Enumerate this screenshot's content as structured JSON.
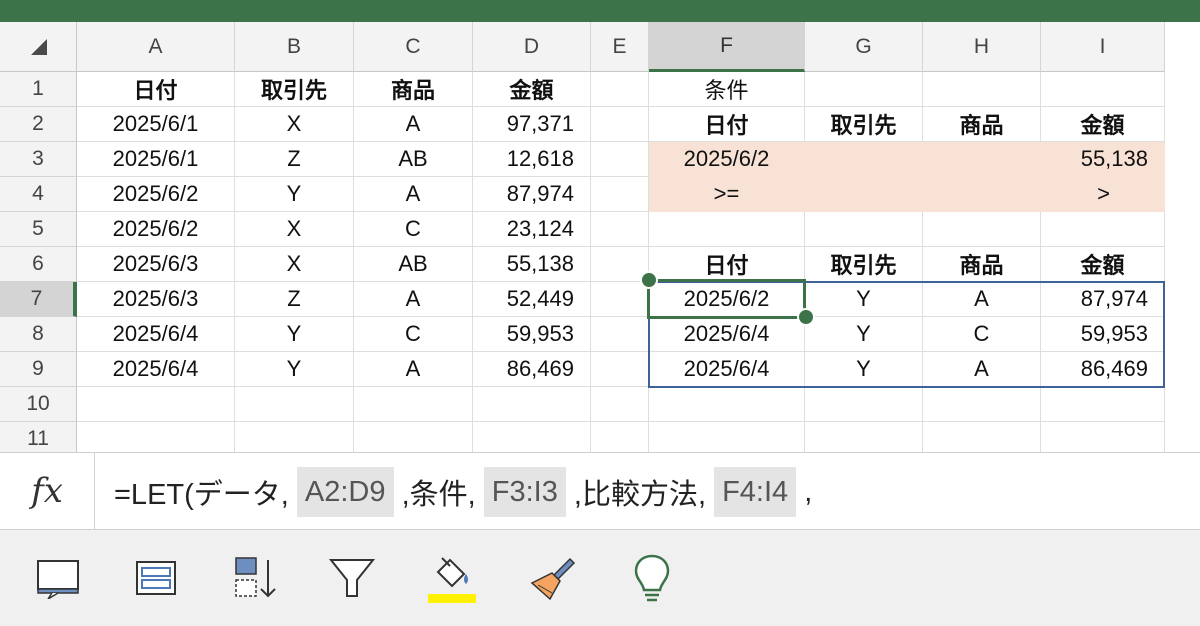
{
  "columns": [
    "A",
    "B",
    "C",
    "D",
    "E",
    "F",
    "G",
    "H",
    "I"
  ],
  "selected_column": "F",
  "rows": [
    "1",
    "2",
    "3",
    "4",
    "5",
    "6",
    "7",
    "8",
    "9",
    "10",
    "11"
  ],
  "selected_row": "7",
  "sheet": {
    "header": [
      "日付",
      "取引先",
      "商品",
      "金額"
    ],
    "data": [
      [
        "2025/6/1",
        "X",
        "A",
        "97,371"
      ],
      [
        "2025/6/1",
        "Z",
        "AB",
        "12,618"
      ],
      [
        "2025/6/2",
        "Y",
        "A",
        "87,974"
      ],
      [
        "2025/6/2",
        "X",
        "C",
        "23,124"
      ],
      [
        "2025/6/3",
        "X",
        "AB",
        "55,138"
      ],
      [
        "2025/6/3",
        "Z",
        "A",
        "52,449"
      ],
      [
        "2025/6/4",
        "Y",
        "C",
        "59,953"
      ],
      [
        "2025/6/4",
        "Y",
        "A",
        "86,469"
      ]
    ]
  },
  "criteria": {
    "label": "条件",
    "header": [
      "日付",
      "取引先",
      "商品",
      "金額"
    ],
    "values": [
      "2025/6/2",
      "",
      "",
      "55,138"
    ],
    "operators": [
      ">=",
      "",
      "",
      ">"
    ]
  },
  "result": {
    "header": [
      "日付",
      "取引先",
      "商品",
      "金額"
    ],
    "rows": [
      [
        "2025/6/2",
        "Y",
        "A",
        "87,974"
      ],
      [
        "2025/6/4",
        "Y",
        "C",
        "59,953"
      ],
      [
        "2025/6/4",
        "Y",
        "A",
        "86,469"
      ]
    ]
  },
  "formula_bar": {
    "fx_label": "fx",
    "parts": [
      {
        "text": "=LET(データ, ",
        "ref": false
      },
      {
        "text": "A2:D9",
        "ref": true
      },
      {
        "text": " ,条件, ",
        "ref": false
      },
      {
        "text": "F3:I3",
        "ref": true
      },
      {
        "text": " ,比較方法, ",
        "ref": false
      },
      {
        "text": "F4:I4",
        "ref": true
      },
      {
        "text": " ,",
        "ref": false
      }
    ]
  },
  "toolbar": {
    "items": [
      "insert-comment-icon",
      "format-table-icon",
      "sort-icon",
      "filter-icon",
      "fill-color-icon",
      "clear-format-icon",
      "ideas-lightbulb-icon"
    ],
    "fill_highlight_color": "#fff200",
    "accent_color": "#3d7349"
  }
}
